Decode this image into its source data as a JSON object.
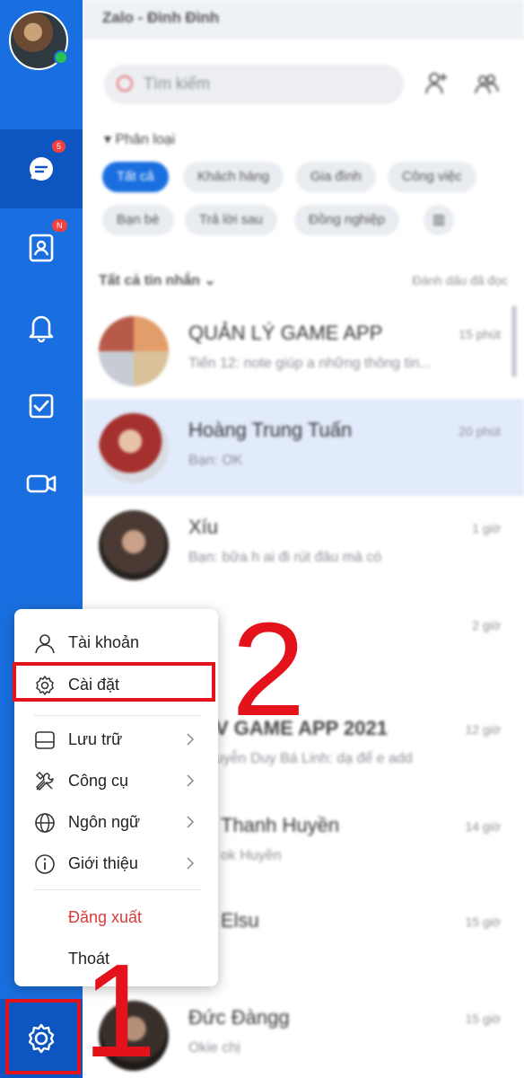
{
  "app": {
    "title": "Zalo - Đình Đình"
  },
  "search": {
    "placeholder": "Tìm kiếm"
  },
  "filters": {
    "label": "Phân loại",
    "chips": [
      "Tất cả",
      "Khách hàng",
      "Gia đình",
      "Công việc",
      "Bạn bè",
      "Trả lời sau",
      "Đồng nghiệp"
    ]
  },
  "list": {
    "header": "Tất cả tin nhắn",
    "mark_read": "Đánh dấu đã đọc",
    "conversations": [
      {
        "name": "QUẢN LÝ GAME APP",
        "message": "Tiến 12: note giúp a những thông tin...",
        "time": "15 phút"
      },
      {
        "name": "Hoàng Trung Tuấn",
        "message": "Bạn: OK",
        "time": "20 phút"
      },
      {
        "name": "Xíu",
        "message": "Bạn: bữa h ai đi rút đâu mà có",
        "time": "1 giờ"
      },
      {
        "name": "",
        "message": "",
        "time": "2 giờ"
      },
      {
        "name": "V GAME APP 2021",
        "message": "uyễn Duy Bá Linh: dạ để e add",
        "time": "12 giờ"
      },
      {
        "name": "Thanh Huyền",
        "message": "ok Huyền",
        "time": "14 giờ"
      },
      {
        "name": "Elsu",
        "message": "",
        "time": "15 giờ"
      },
      {
        "name": "Đức Đàngg",
        "message": "Okie chị",
        "time": "15 giờ"
      }
    ]
  },
  "badges": {
    "messages": "5",
    "contacts": "N"
  },
  "menu": {
    "account": "Tài khoản",
    "settings": "Cài đặt",
    "storage": "Lưu trữ",
    "tools": "Công cụ",
    "language": "Ngôn ngữ",
    "about": "Giới thiệu",
    "logout": "Đăng xuất",
    "quit": "Thoát"
  },
  "annotations": {
    "step1": "1",
    "step2": "2"
  },
  "colors": {
    "sidebar": "#1a6fe0",
    "sidebar_active": "#0d55c0",
    "highlight": "#e4131b",
    "danger": "#d73b3b"
  }
}
